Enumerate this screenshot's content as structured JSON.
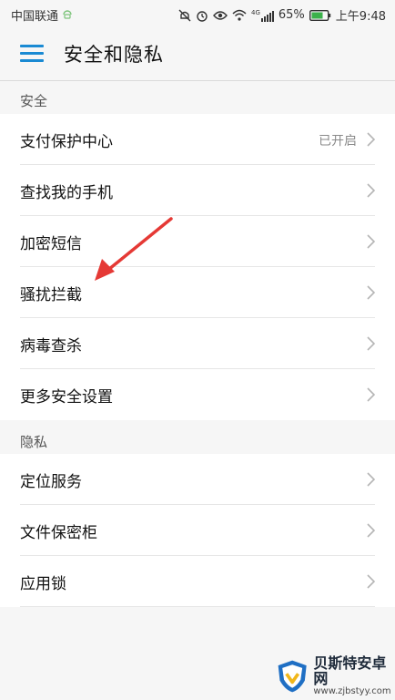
{
  "status_bar": {
    "carrier": "中国联通",
    "battery_percent": "65%",
    "time": "上午9:48",
    "network_type": "4G",
    "icons": [
      "mute-icon",
      "alarm-icon",
      "eye-icon",
      "wifi-icon",
      "signal-icon",
      "battery-icon"
    ]
  },
  "header": {
    "title": "安全和隐私",
    "menu_icon": "menu-icon"
  },
  "sections": [
    {
      "label": "安全",
      "items": [
        {
          "label": "支付保护中心",
          "value": "已开启"
        },
        {
          "label": "查找我的手机",
          "value": ""
        },
        {
          "label": "加密短信",
          "value": ""
        },
        {
          "label": "骚扰拦截",
          "value": ""
        },
        {
          "label": "病毒查杀",
          "value": ""
        },
        {
          "label": "更多安全设置",
          "value": ""
        }
      ]
    },
    {
      "label": "隐私",
      "items": [
        {
          "label": "定位服务",
          "value": ""
        },
        {
          "label": "文件保密柜",
          "value": ""
        },
        {
          "label": "应用锁",
          "value": ""
        }
      ]
    }
  ],
  "watermark": {
    "title": "贝斯特安卓网",
    "url": "www.zjbstyy.com"
  },
  "colors": {
    "accent": "#1a8ad3",
    "annotation": "#e53935",
    "background": "#f6f6f6"
  }
}
